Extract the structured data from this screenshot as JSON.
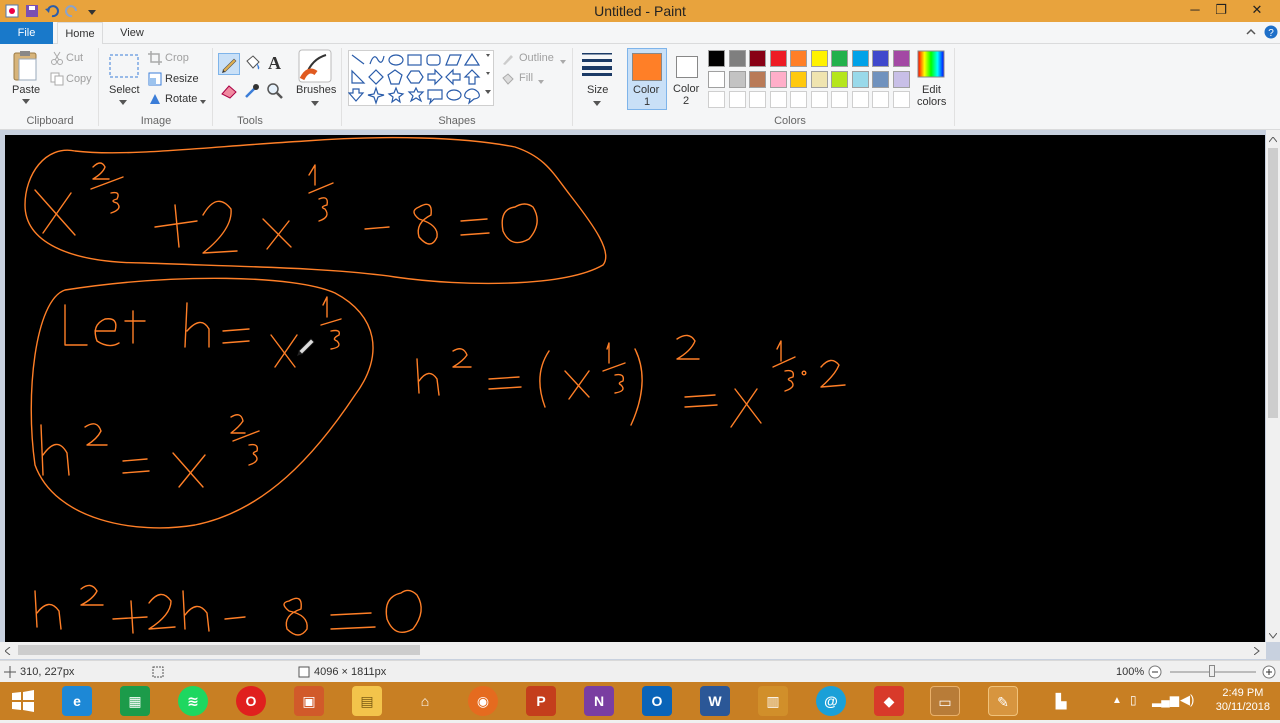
{
  "window": {
    "title": "Untitled - Paint",
    "min": "─",
    "max": "❐",
    "close": "✕"
  },
  "tabs": {
    "file": "File",
    "home": "Home",
    "view": "View"
  },
  "ribbon": {
    "clipboard": {
      "paste": "Paste",
      "cut": "Cut",
      "copy": "Copy",
      "group": "Clipboard"
    },
    "image": {
      "select": "Select",
      "crop": "Crop",
      "resize": "Resize",
      "rotate": "Rotate",
      "group": "Image"
    },
    "tools": {
      "group": "Tools",
      "text_glyph": "A"
    },
    "brushes": {
      "label": "Brushes"
    },
    "shapes": {
      "outline": "Outline",
      "fill": "Fill",
      "group": "Shapes"
    },
    "size": {
      "label": "Size"
    },
    "color1": {
      "label": "Color",
      "num": "1",
      "value": "#ff7f27"
    },
    "color2": {
      "label": "Color",
      "num": "2",
      "value": "#ffffff"
    },
    "colors": {
      "group": "Colors",
      "edit_label": "Edit",
      "edit_label2": "colors",
      "row1": [
        "#000000",
        "#7f7f7f",
        "#880015",
        "#ed1c24",
        "#ff7f27",
        "#fff200",
        "#22b14c",
        "#00a2e8",
        "#3f48cc",
        "#a349a4"
      ],
      "row2": [
        "#ffffff",
        "#c3c3c3",
        "#b97a57",
        "#ffaec9",
        "#ffc90e",
        "#efe4b0",
        "#b5e61d",
        "#99d9ea",
        "#7092be",
        "#c8bfe7"
      ]
    }
  },
  "status": {
    "cursor_pos": "310, 227px",
    "image_size": "4096 × 1811px",
    "zoom": "100%"
  },
  "taskbar": {
    "time": "2:49 PM",
    "date": "30/11/2018"
  },
  "ink_color": "#ff7f27"
}
